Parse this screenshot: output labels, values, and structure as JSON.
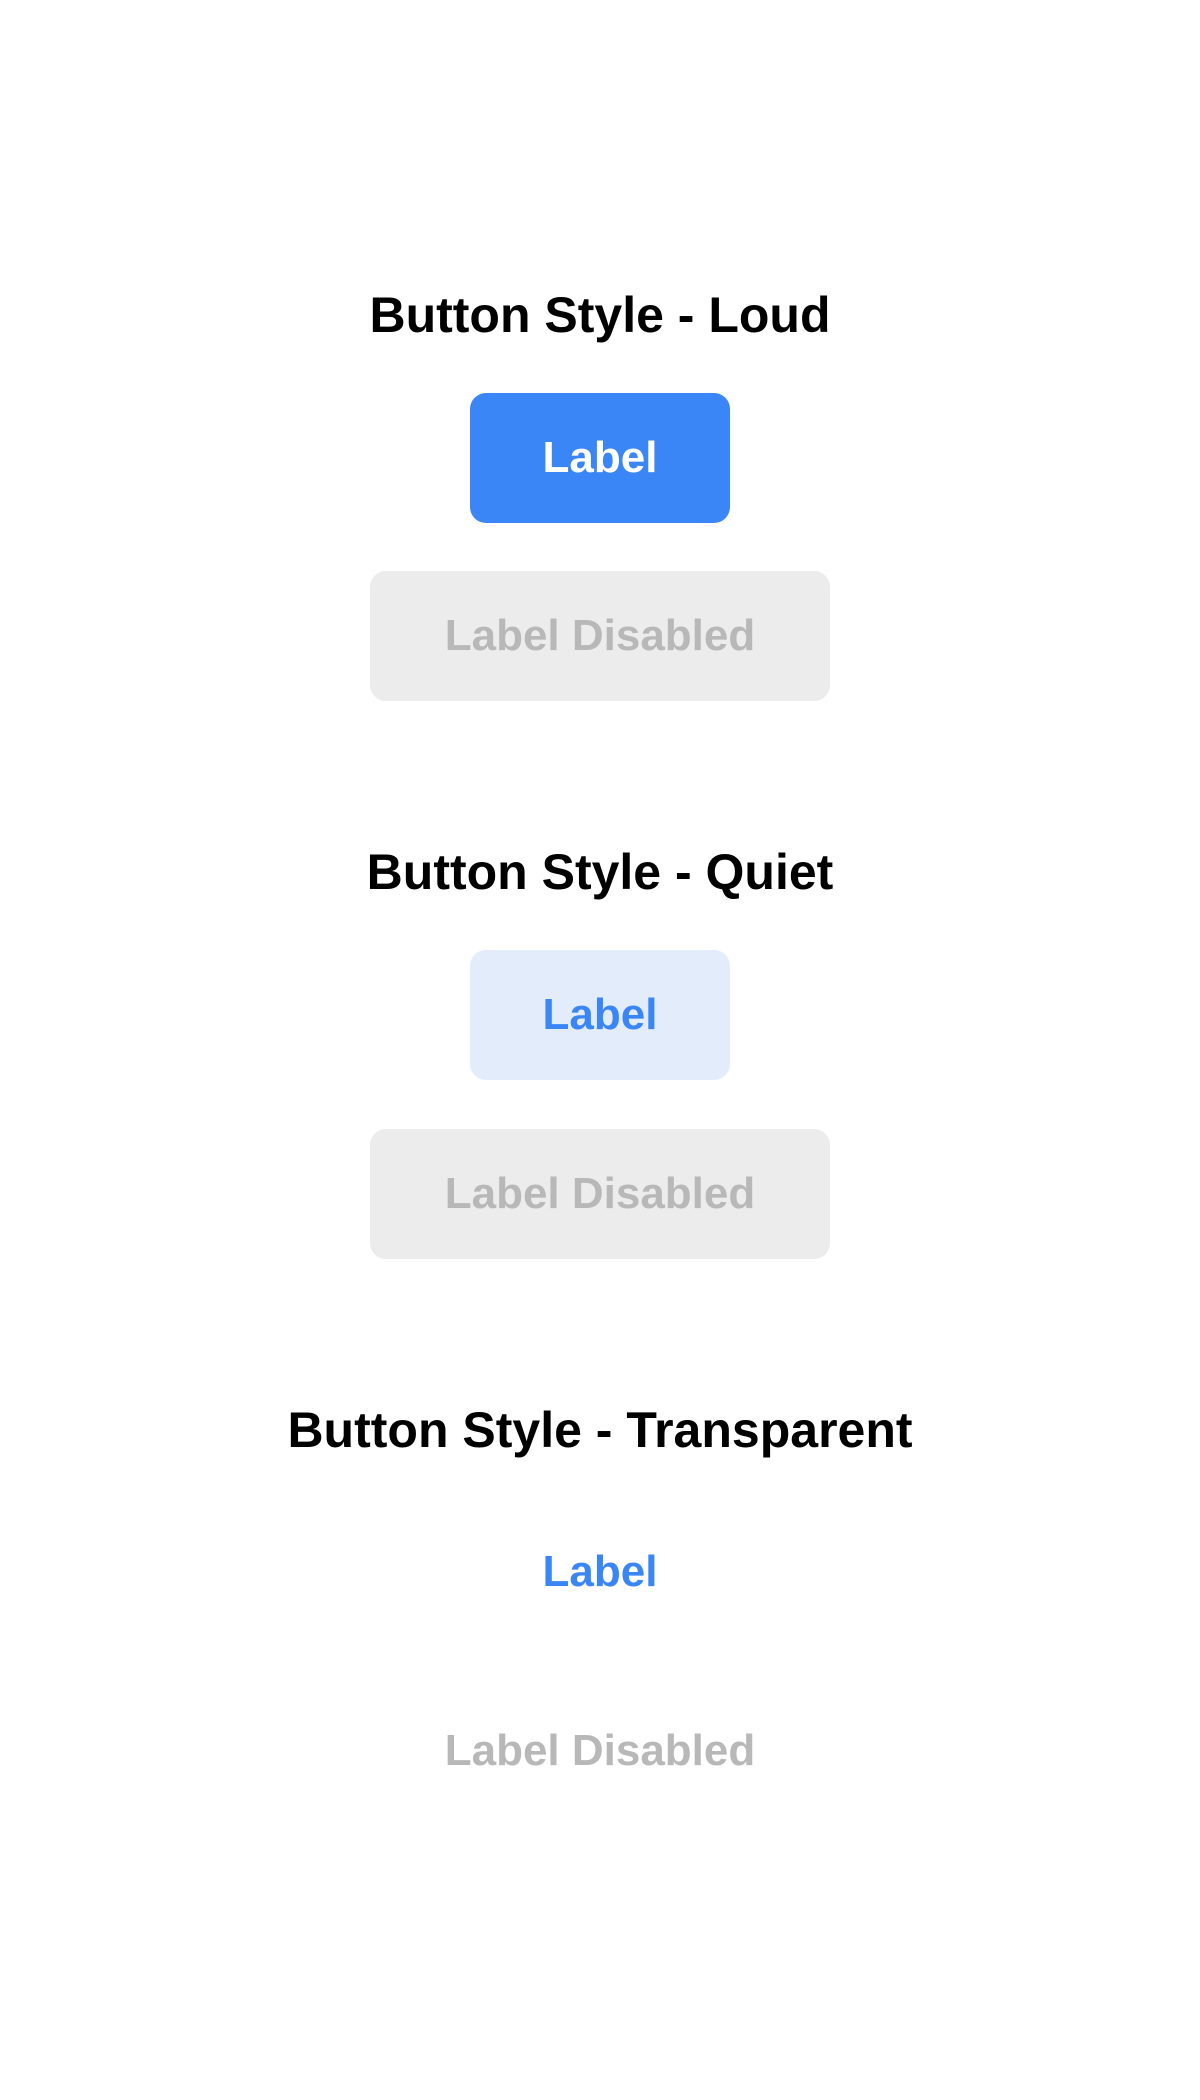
{
  "colors": {
    "accent": "#3a86f7",
    "quiet_bg": "#e3ecfb",
    "disabled_bg": "#ececec",
    "disabled_text": "#b8b8b8",
    "heading_text": "#000000"
  },
  "sections": [
    {
      "heading": "Button Style - Loud",
      "button_label": "Label",
      "disabled_label": "Label Disabled"
    },
    {
      "heading": "Button Style - Quiet",
      "button_label": "Label",
      "disabled_label": "Label Disabled"
    },
    {
      "heading": "Button Style - Transparent",
      "button_label": "Label",
      "disabled_label": "Label Disabled"
    }
  ]
}
